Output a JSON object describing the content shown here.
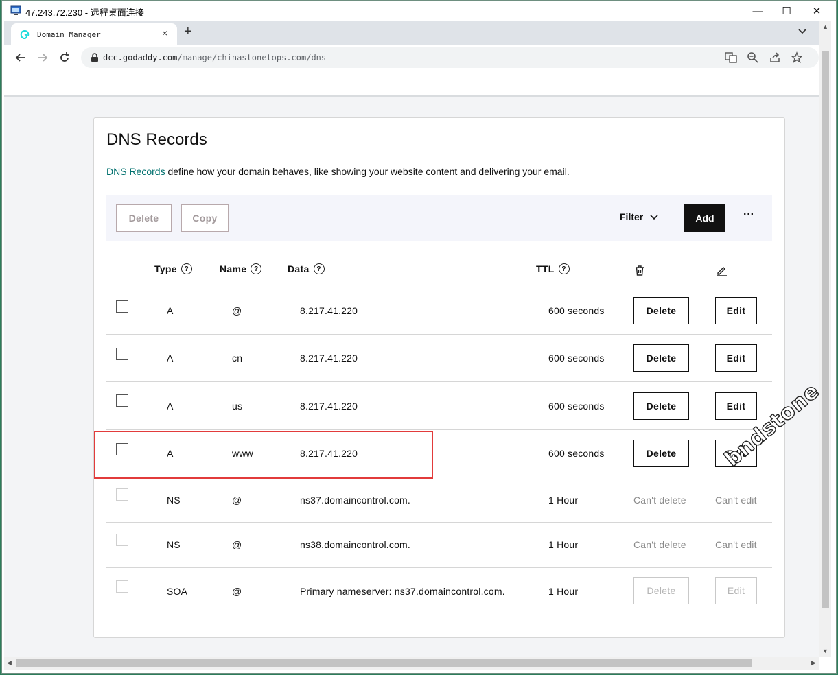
{
  "window": {
    "title": "47.243.72.230 - 远程桌面连接",
    "controls": {
      "minimize": "—",
      "maximize": "☐",
      "close": "✕"
    }
  },
  "browser": {
    "tab_title": "Domain Manager",
    "tab_close": "×",
    "new_tab": "+",
    "url_host": "dcc.godaddy.com",
    "url_path": "/manage/chinastonetops.com/dns"
  },
  "dns": {
    "title": "DNS Records",
    "desc_link": "DNS Records",
    "desc_rest": " define how your domain behaves, like showing your website content and delivering your email.",
    "toolbar": {
      "delete_label": "Delete",
      "copy_label": "Copy",
      "filter_label": "Filter",
      "add_label": "Add",
      "more_label": "···"
    },
    "columns": {
      "type": "Type",
      "name": "Name",
      "data": "Data",
      "ttl": "TTL"
    },
    "rows": [
      {
        "type": "A",
        "name": "@",
        "data": "8.217.41.220",
        "ttl": "600 seconds",
        "delete": "Delete",
        "edit": "Edit"
      },
      {
        "type": "A",
        "name": "cn",
        "data": "8.217.41.220",
        "ttl": "600 seconds",
        "delete": "Delete",
        "edit": "Edit"
      },
      {
        "type": "A",
        "name": "us",
        "data": "8.217.41.220",
        "ttl": "600 seconds",
        "delete": "Delete",
        "edit": "Edit"
      },
      {
        "type": "A",
        "name": "www",
        "data": "8.217.41.220",
        "ttl": "600 seconds",
        "delete": "Delete",
        "edit": "Edit"
      },
      {
        "type": "NS",
        "name": "@",
        "data": "ns37.domaincontrol.com.",
        "ttl": "1 Hour",
        "delete": "Can't delete",
        "edit": "Can't edit"
      },
      {
        "type": "NS",
        "name": "@",
        "data": "ns38.domaincontrol.com.",
        "ttl": "1 Hour",
        "delete": "Can't delete",
        "edit": "Can't edit"
      },
      {
        "type": "SOA",
        "name": "@",
        "data": "Primary nameserver: ns37.domaincontrol.com.",
        "ttl": "1 Hour",
        "delete": "Delete",
        "edit": "Edit"
      }
    ]
  },
  "watermark": "bndstone.com"
}
